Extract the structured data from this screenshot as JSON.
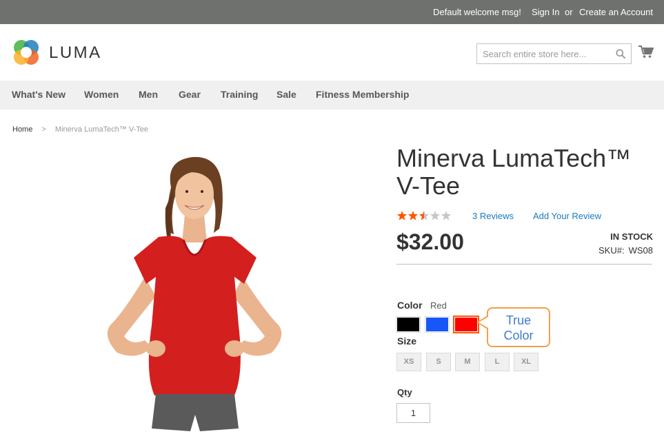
{
  "topbar": {
    "welcome": "Default welcome msg!",
    "sign_in": "Sign In",
    "or": "or",
    "create_account": "Create an Account"
  },
  "header": {
    "logo_text": "LUMA",
    "search_placeholder": "Search entire store here...",
    "icons": [
      "search-icon",
      "cart-icon"
    ]
  },
  "nav": {
    "items": [
      "What's New",
      "Women",
      "Men",
      "Gear",
      "Training",
      "Sale",
      "Fitness Membership"
    ]
  },
  "breadcrumb": {
    "home": "Home",
    "separator": ">",
    "current": "Minerva LumaTech™ V-Tee"
  },
  "product": {
    "title": "Minerva LumaTech™ V-Tee",
    "rating_stars": 2.5,
    "rating_max": 5,
    "reviews_link": "3 Reviews",
    "add_review": "Add Your Review",
    "price": "$32.00",
    "stock": "In stock",
    "sku_label": "SKU#:",
    "sku": "WS08"
  },
  "options": {
    "color_label": "Color",
    "color_selected": "Red",
    "swatches": [
      {
        "name": "Black",
        "color": "#000000"
      },
      {
        "name": "Blue",
        "color": "#1857f7"
      },
      {
        "name": "Red",
        "color": "#ff0000",
        "selected": true
      }
    ],
    "size_label": "Size",
    "sizes": [
      "XS",
      "S",
      "M",
      "L",
      "XL"
    ],
    "qty_label": "Qty",
    "qty_value": "1"
  },
  "callout": {
    "line1": "True",
    "line2": "Color"
  },
  "colors": {
    "topbar_bg": "#6e716e",
    "nav_bg": "#f0f0f0",
    "link": "#1979c3",
    "star": "#ff5501",
    "callout_border": "#f0a04b"
  }
}
